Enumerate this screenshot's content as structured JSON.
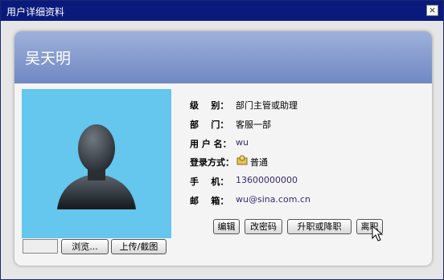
{
  "window": {
    "title": "用户详细资料",
    "close_label": "×"
  },
  "header": {
    "user_name": "吴天明"
  },
  "photo": {
    "icon": "user-silhouette-icon"
  },
  "upload": {
    "browse_label": "浏览...",
    "upload_label": "上传/截图"
  },
  "fields": {
    "level": {
      "label": "级    别：",
      "value": "部门主管或助理"
    },
    "department": {
      "label": "部    门：",
      "value": "客服一部"
    },
    "username": {
      "label": "用 户 名：",
      "value": "wu"
    },
    "login": {
      "label": "登录方式：",
      "value": "普通",
      "icon": "login-user-icon"
    },
    "mobile": {
      "label": "手    机：",
      "value": "13600000000"
    },
    "email": {
      "label": "邮    箱：",
      "value": "wu@sina.com.cn"
    }
  },
  "actions": {
    "edit_label": "编辑",
    "password_label": "改密码",
    "promote_label": "升职或降职",
    "resign_label": "离职"
  },
  "colors": {
    "titlebar": "#0a1a7c",
    "header_top": "#9eb1db",
    "header_bottom": "#7088c3",
    "photo_bg": "#65c6ee",
    "value_purple": "#3a2a70"
  }
}
